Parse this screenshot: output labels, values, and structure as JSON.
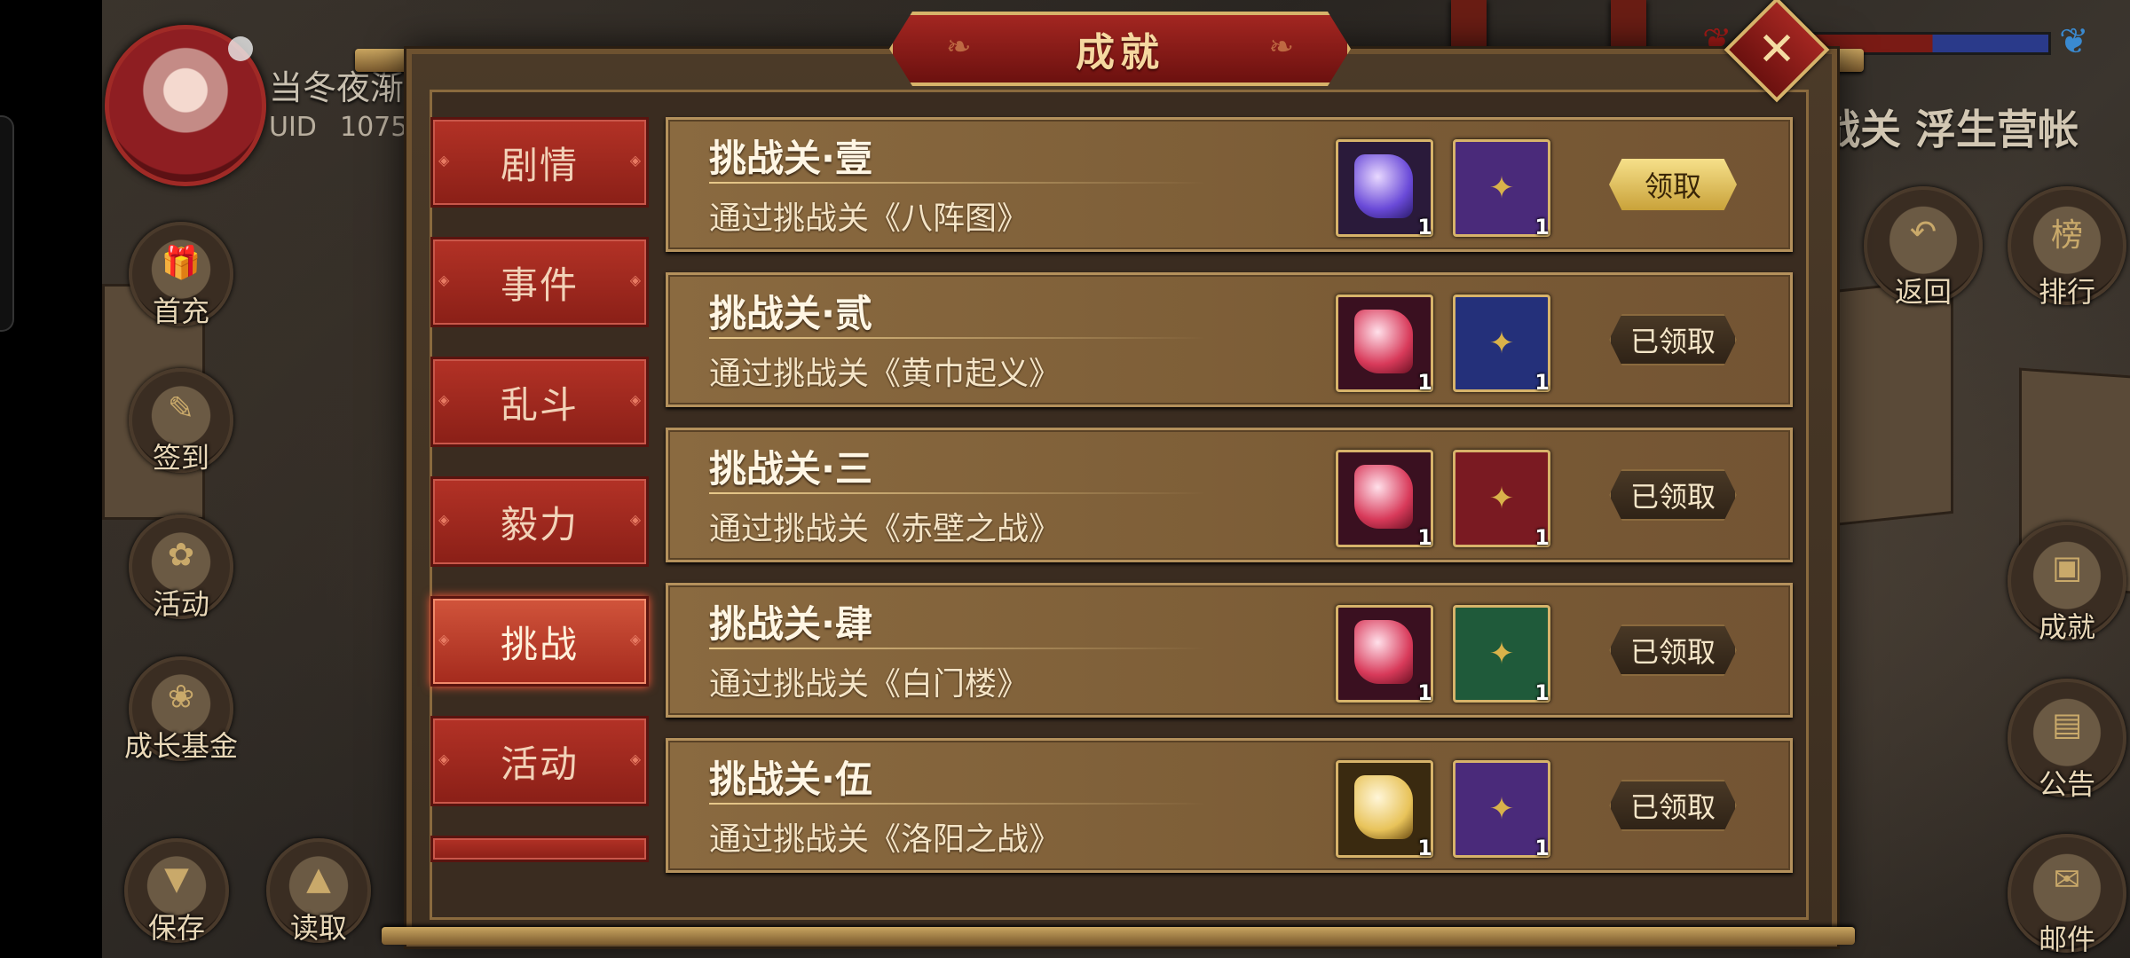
{
  "player": {
    "name": "当冬夜渐",
    "uid_label": "UID",
    "uid_value": "1075"
  },
  "location": "战关 浮生营帐",
  "side_left": [
    {
      "label": "首充",
      "icon": "gift-icon"
    },
    {
      "label": "签到",
      "icon": "checkin-icon"
    },
    {
      "label": "活动",
      "icon": "flower-icon"
    },
    {
      "label": "成长基金",
      "icon": "fund-icon"
    },
    {
      "label": "保存",
      "icon": "save-icon"
    },
    {
      "label": "读取",
      "icon": "load-icon"
    }
  ],
  "side_right": [
    {
      "label": "返回",
      "icon": "return-icon"
    },
    {
      "label": "排行",
      "icon": "ranking-icon",
      "glyph": "榜"
    },
    {
      "label": "成就",
      "icon": "achievement-icon"
    },
    {
      "label": "公告",
      "icon": "notice-icon"
    },
    {
      "label": "邮件",
      "icon": "mail-icon"
    }
  ],
  "dialog": {
    "title": "成就",
    "close_glyph": "✕"
  },
  "tabs": [
    {
      "label": "剧情",
      "active": false
    },
    {
      "label": "事件",
      "active": false
    },
    {
      "label": "乱斗",
      "active": false
    },
    {
      "label": "毅力",
      "active": false
    },
    {
      "label": "挑战",
      "active": true
    },
    {
      "label": "活动",
      "active": false
    }
  ],
  "achievements": [
    {
      "title": "挑战关·壹",
      "desc": "通过挑战关《八阵图》",
      "rewards": [
        {
          "type": "purple-gem",
          "qty": "1"
        },
        {
          "type": "purple-book",
          "qty": "1"
        }
      ],
      "button": "领取",
      "state": "ready"
    },
    {
      "title": "挑战关·贰",
      "desc": "通过挑战关《黄巾起义》",
      "rewards": [
        {
          "type": "red-gem",
          "qty": "1"
        },
        {
          "type": "blue-book",
          "qty": "1"
        }
      ],
      "button": "已领取",
      "state": "done"
    },
    {
      "title": "挑战关·三",
      "desc": "通过挑战关《赤壁之战》",
      "rewards": [
        {
          "type": "red-gem",
          "qty": "1"
        },
        {
          "type": "red-book",
          "qty": "1"
        }
      ],
      "button": "已领取",
      "state": "done"
    },
    {
      "title": "挑战关·肆",
      "desc": "通过挑战关《白门楼》",
      "rewards": [
        {
          "type": "red-gem",
          "qty": "1"
        },
        {
          "type": "green-book",
          "qty": "1"
        }
      ],
      "button": "已领取",
      "state": "done"
    },
    {
      "title": "挑战关·伍",
      "desc": "通过挑战关《洛阳之战》",
      "rewards": [
        {
          "type": "gold-gem",
          "qty": "1"
        },
        {
          "type": "purple-book",
          "qty": "1"
        }
      ],
      "button": "已领取",
      "state": "done"
    }
  ],
  "colors": {
    "purple-gem": "#6a4ad8",
    "red-gem": "#d83a5a",
    "gold-gem": "#e8c35a",
    "purple-book": "#4a2a7a",
    "blue-book": "#24307a",
    "red-book": "#7a1a22",
    "green-book": "#1f5a3a"
  }
}
